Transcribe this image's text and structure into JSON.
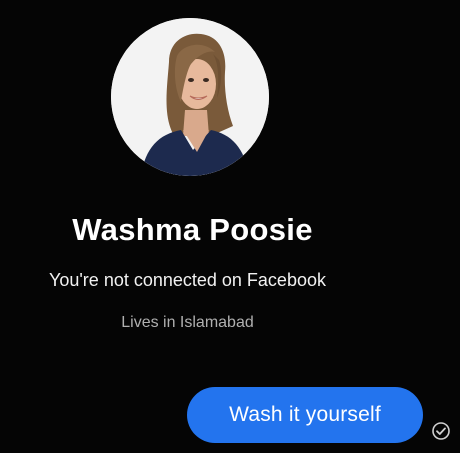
{
  "profile": {
    "name": "Washma Poosie",
    "connection_status": "You're not connected on Facebook",
    "location": "Lives in Islamabad"
  },
  "conversation": {
    "messages": [
      {
        "sender": "me",
        "text": "Wash it yourself",
        "status_icon": "sent-check-icon"
      }
    ]
  },
  "colors": {
    "background": "#050505",
    "bubble": "#2374ee",
    "secondary_text": "#b0b0b0"
  }
}
